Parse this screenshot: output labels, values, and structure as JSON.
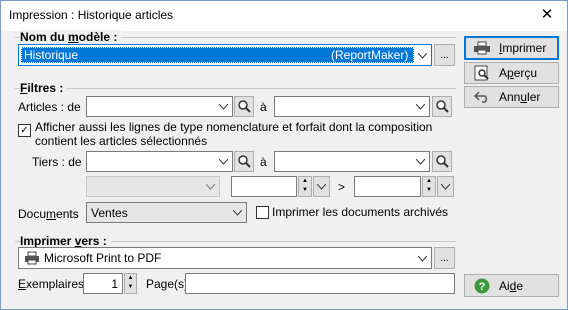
{
  "window": {
    "title": "Impression : Historique articles",
    "close_glyph": "✕"
  },
  "modele": {
    "group_title_pre": "Nom du ",
    "group_title_u": "m",
    "group_title_post": "odèle :",
    "value": "Historique",
    "source": "(ReportMaker)",
    "more_label": "..."
  },
  "filtres": {
    "group_title_u": "F",
    "group_title_post": "iltres :",
    "articles_label": "Articles : de",
    "a_label": "à",
    "checkbox_checked": true,
    "checkbox_line1": "Afficher aussi les lignes de type nomenclature et forfait dont la composition",
    "checkbox_line2": "contient les articles sélectionnés",
    "tiers_label": "Tiers : de",
    "tiers_a_label": "à",
    "gt_label": ">",
    "documents_label_pre": "Docu",
    "documents_label_u": "m",
    "documents_label_post": "ents",
    "documents_value": "Ventes",
    "archives_checked": false,
    "archives_label": "Imprimer les documents archivés"
  },
  "imprimer_vers": {
    "group_title_pre": "Imprimer ",
    "group_title_u": "v",
    "group_title_post": "ers :",
    "printer": "Microsoft Print to PDF",
    "more_label": "...",
    "exemplaires_label_u": "E",
    "exemplaires_label_post": "xemplaires",
    "exemplaires_value": "1",
    "pages_label": "Page(s)",
    "pages_value": ""
  },
  "buttons": {
    "imprimer_u": "I",
    "imprimer_post": "mprimer",
    "apercu_pre": "A",
    "apercu_u": "p",
    "apercu_post": "erçu",
    "annuler_pre": "Ann",
    "annuler_u": "u",
    "annuler_post": "ler",
    "aide_pre": "Ai",
    "aide_u": "d",
    "aide_post": "e"
  },
  "colors": {
    "selection": "#0078d7",
    "accent_border": "#0078d7",
    "help_icon": "#3c9a3c"
  }
}
